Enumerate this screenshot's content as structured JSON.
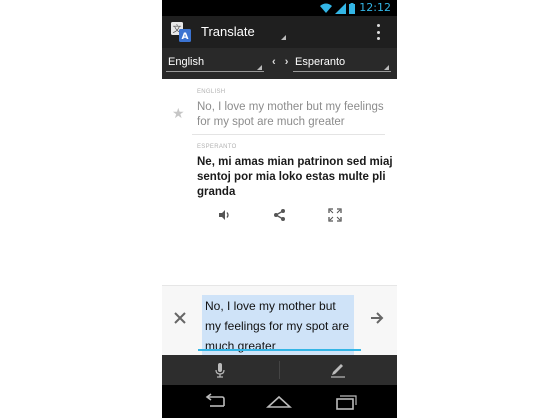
{
  "status_bar": {
    "time": "12:12"
  },
  "action_bar": {
    "title": "Translate"
  },
  "languages": {
    "source": "English",
    "target": "Esperanto",
    "swap_glyph": "‹ ›"
  },
  "source": {
    "label": "ENGLISH",
    "text": "No, I love my mother but my feelings for my spot are much greater"
  },
  "translation": {
    "label": "ESPERANTO",
    "text": "Ne, mi amas mian patrinon sed miaj sentoj por mia loko estas multe pli granda"
  },
  "translation_actions": [
    "speaker-icon",
    "share-icon",
    "fullscreen-icon"
  ],
  "input": {
    "value": "No, I love my mother but my feelings for my spot are much greater"
  },
  "bottom_actions": [
    "microphone-icon",
    "pencil-icon"
  ],
  "nav_bar": [
    "back-icon",
    "home-icon",
    "recent-apps-icon"
  ],
  "colors": {
    "accent": "#33b5e5",
    "action_bar": "#1f1f1f",
    "language_bar": "#292929",
    "selection": "#cfe3f8"
  }
}
